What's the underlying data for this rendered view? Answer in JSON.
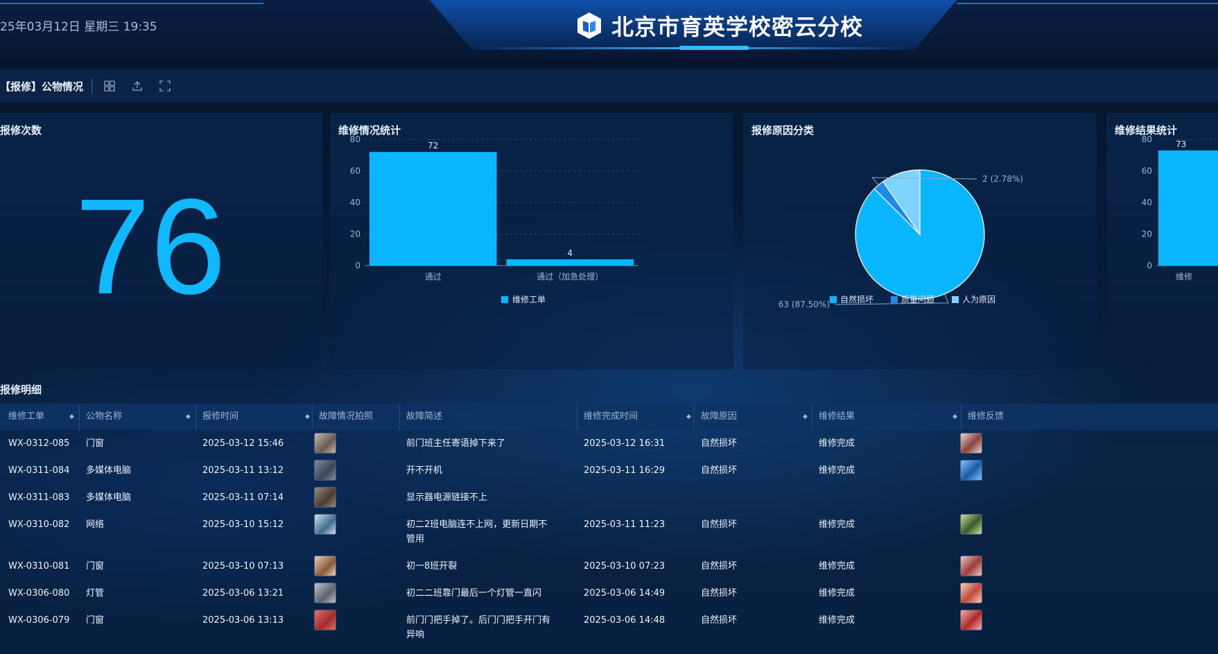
{
  "header": {
    "datetime": "25年03月12日 星期三 19:35",
    "school_name": "北京市育英学校密云分校"
  },
  "toolbar": {
    "page_label": "【报修】公物情况",
    "icons": [
      "grid-icon",
      "upload-icon",
      "fullscreen-icon"
    ]
  },
  "panels": {
    "count": {
      "title": "报修次数",
      "value": "76"
    },
    "repair_stats": {
      "title": "维修情况统计"
    },
    "reason": {
      "title": "报修原因分类"
    },
    "result": {
      "title": "维修结果统计"
    }
  },
  "chart_data": [
    {
      "type": "bar",
      "title": "维修情况统计",
      "categories": [
        "通过",
        "通过（加急处理）"
      ],
      "series": [
        {
          "name": "维修工单",
          "values": [
            72,
            4
          ]
        }
      ],
      "ylim": [
        0,
        80
      ],
      "yticks": [
        0,
        20,
        40,
        60,
        80
      ],
      "data_labels": [
        "72",
        "4"
      ],
      "grid": true,
      "legend": "bottom",
      "colors": [
        "#0ab6ff"
      ]
    },
    {
      "type": "pie",
      "title": "报修原因分类",
      "labels": [
        "自然损坏",
        "质量问题",
        "人为原因"
      ],
      "values": [
        63,
        2,
        7
      ],
      "data_labels": [
        "63 (87.50%)",
        "2 (2.78%)"
      ],
      "colors": [
        "#0ab6ff",
        "#1f8be6",
        "#7fd3ff"
      ],
      "legend": "bottom"
    },
    {
      "type": "bar",
      "title": "维修结果统计",
      "categories": [
        "维修"
      ],
      "series": [
        {
          "values": [
            73
          ]
        }
      ],
      "ylim": [
        0,
        80
      ],
      "yticks": [
        0,
        20,
        40,
        60,
        80
      ],
      "data_labels": [
        "73"
      ],
      "colors": [
        "#0ab6ff"
      ]
    }
  ],
  "table": {
    "title": "报修明细",
    "columns": [
      "维修工单",
      "公物名称",
      "报修时间",
      "故障情况拍照",
      "故障简述",
      "维修完成时间",
      "故障原因",
      "维修结果",
      "维修反馈"
    ],
    "rows": [
      {
        "order": "WX-0312-085",
        "item": "门窗",
        "report_time": "2025-03-12 15:46",
        "photo": "photo-thumb",
        "desc": "前门班主任寄语掉下来了",
        "done_time": "2025-03-12 16:31",
        "reason": "自然损坏",
        "result": "维修完成",
        "feedback": "feedback-thumb"
      },
      {
        "order": "WX-0311-084",
        "item": "多媒体电脑",
        "report_time": "2025-03-11 13:12",
        "photo": "photo-thumb",
        "desc": "开不开机",
        "done_time": "2025-03-11 16:29",
        "reason": "自然损坏",
        "result": "维修完成",
        "feedback": "feedback-thumb"
      },
      {
        "order": "WX-0311-083",
        "item": "多媒体电脑",
        "report_time": "2025-03-11 07:14",
        "photo": "photo-thumb",
        "desc": "显示器电源链接不上",
        "done_time": "",
        "reason": "",
        "result": "",
        "feedback": ""
      },
      {
        "order": "WX-0310-082",
        "item": "网络",
        "report_time": "2025-03-10 15:12",
        "photo": "photo-thumb",
        "desc": "初二2班电脑连不上网，更新日期不管用",
        "done_time": "2025-03-11 11:23",
        "reason": "自然损坏",
        "result": "维修完成",
        "feedback": "feedback-thumb"
      },
      {
        "order": "WX-0310-081",
        "item": "门窗",
        "report_time": "2025-03-10 07:13",
        "photo": "photo-thumb",
        "desc": "初一8班开裂",
        "done_time": "2025-03-10 07:23",
        "reason": "自然损坏",
        "result": "维修完成",
        "feedback": "feedback-thumb"
      },
      {
        "order": "WX-0306-080",
        "item": "灯管",
        "report_time": "2025-03-06 13:21",
        "photo": "photo-thumb",
        "desc": "初二二班靠门最后一个灯管一直闪",
        "done_time": "2025-03-06 14:49",
        "reason": "自然损坏",
        "result": "维修完成",
        "feedback": "feedback-thumb"
      },
      {
        "order": "WX-0306-079",
        "item": "门窗",
        "report_time": "2025-03-06 13:13",
        "photo": "photo-thumb",
        "desc": "前门门把手掉了。后门门把手开门有异响",
        "done_time": "2025-03-06 14:48",
        "reason": "自然损坏",
        "result": "维修完成",
        "feedback": "feedback-thumb"
      }
    ]
  }
}
